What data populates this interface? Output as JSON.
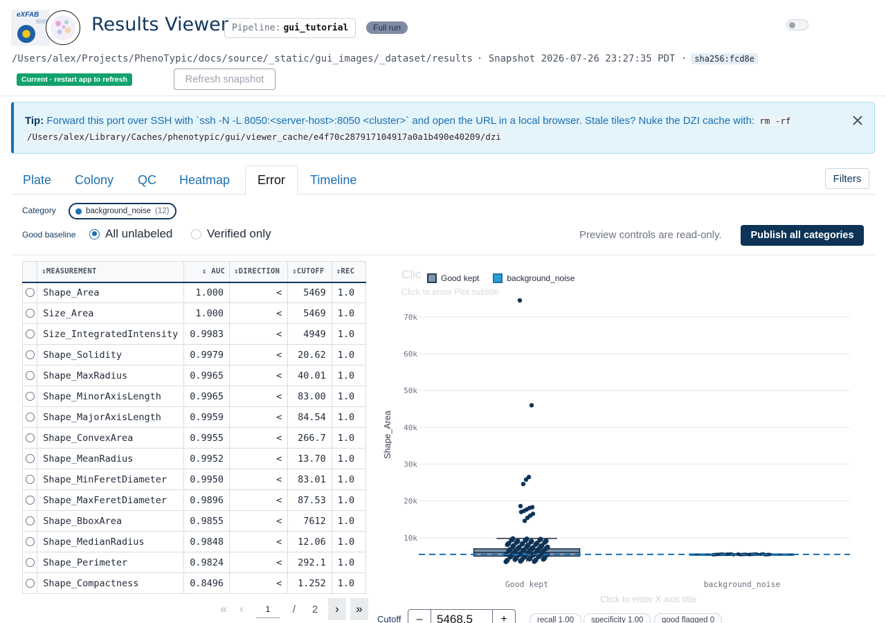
{
  "header": {
    "title": "Results Viewer",
    "pipeline_key": "Pipeline:",
    "pipeline_value": "gui_tutorial",
    "run_badge": "Full run",
    "path": "/Users/alex/Projects/PhenoTypic/docs/source/_static/gui_images/_dataset/results",
    "snapshot": "· Snapshot 2026-07-26 23:27:35 PDT ·",
    "hash": "sha256:fcd8e",
    "current_badge": "Current · restart app to refresh",
    "refresh_label": "Refresh snapshot",
    "logo_text": "eXFAB"
  },
  "tip": {
    "label": "Tip:",
    "text1": "Forward this port over SSH with `ssh -N -L 8050:<server-host>:8050 <cluster>` and open the URL in a local browser. Stale tiles? Nuke the DZI cache with:",
    "code1": "rm -rf",
    "code2": "/Users/alex/Library/Caches/phenotypic/gui/viewer_cache/e4f70c287917104917a0a1b490e40209/dzi"
  },
  "tabs": [
    "Plate",
    "Colony",
    "QC",
    "Heatmap",
    "Error",
    "Timeline"
  ],
  "active_tab": "Error",
  "filters_label": "Filters",
  "controls": {
    "category_label": "Category",
    "category_name": "background_noise",
    "category_count": "(12)",
    "baseline_label": "Good baseline",
    "opt_all": "All unlabeled",
    "opt_verified": "Verified only",
    "preview_note": "Preview controls are read-only.",
    "publish_label": "Publish all categories"
  },
  "table": {
    "headers": [
      "⇕MEASUREMENT",
      "⇕ AUC",
      "⇕DIRECTION",
      "⇕CUTOFF",
      "⇕REC"
    ],
    "rows": [
      [
        "Shape_Area",
        "1.000",
        "<",
        "5469",
        "1.0"
      ],
      [
        "Size_Area",
        "1.000",
        "<",
        "5469",
        "1.0"
      ],
      [
        "Size_IntegratedIntensity",
        "0.9983",
        "<",
        "4949",
        "1.0"
      ],
      [
        "Shape_Solidity",
        "0.9979",
        "<",
        "20.62",
        "1.0"
      ],
      [
        "Shape_MaxRadius",
        "0.9965",
        "<",
        "40.01",
        "1.0"
      ],
      [
        "Shape_MinorAxisLength",
        "0.9965",
        "<",
        "83.00",
        "1.0"
      ],
      [
        "Shape_MajorAxisLength",
        "0.9959",
        "<",
        "84.54",
        "1.0"
      ],
      [
        "Shape_ConvexArea",
        "0.9955",
        "<",
        "266.7",
        "1.0"
      ],
      [
        "Shape_MeanRadius",
        "0.9952",
        "<",
        "13.70",
        "1.0"
      ],
      [
        "Shape_MinFeretDiameter",
        "0.9950",
        "<",
        "83.01",
        "1.0"
      ],
      [
        "Shape_MaxFeretDiameter",
        "0.9896",
        "<",
        "87.53",
        "1.0"
      ],
      [
        "Shape_BboxArea",
        "0.9855",
        "<",
        "7612",
        "1.0"
      ],
      [
        "Shape_MedianRadius",
        "0.9848",
        "<",
        "12.06",
        "1.0"
      ],
      [
        "Shape_Perimeter",
        "0.9824",
        "<",
        "292.1",
        "1.0"
      ],
      [
        "Shape_Compactness",
        "0.8496",
        "<",
        "1.252",
        "1.0"
      ]
    ]
  },
  "pager": {
    "current": "1",
    "sep": "/",
    "total": "2"
  },
  "chart_placeholders": {
    "title": "Clic",
    "subtitle": "Click to enter Plot subtitle",
    "xtitle": "Click to enter X axis title"
  },
  "chart_data": {
    "type": "box",
    "ylabel": "Shape_Area",
    "categories": [
      "Good kept",
      "background_noise"
    ],
    "legend": [
      "Good kept",
      "background_noise"
    ],
    "y_ticks": [
      10000,
      20000,
      30000,
      40000,
      50000,
      60000,
      70000
    ],
    "y_tick_labels": [
      "10k",
      "20k",
      "30k",
      "40k",
      "50k",
      "60k",
      "70k"
    ],
    "ylim": [
      0,
      76000
    ],
    "cutoff_line": 5468.5,
    "boxes": [
      {
        "name": "Good kept",
        "q1": 5000,
        "median": 6000,
        "q3": 7000,
        "whisker_low": 3500,
        "whisker_high": 9800,
        "outliers": [
          74500,
          46000,
          26500,
          25800,
          24600,
          18600,
          18300,
          18100,
          17700,
          17300,
          17000,
          16500,
          16000,
          15400,
          14600
        ]
      },
      {
        "name": "background_noise",
        "q1": 5400,
        "median": 5500,
        "q3": 5600,
        "whisker_low": 5300,
        "whisker_high": 5700,
        "outliers": []
      }
    ],
    "colors": {
      "good": "#7d95b0",
      "noise": "#2e9fd4",
      "points": "#0e3357",
      "cutoff": "#1a6fb0"
    }
  },
  "cutoff": {
    "label": "Cutoff",
    "minus": "–",
    "value": "5468.5",
    "plus": "+",
    "recall": "recall 1.00",
    "specificity": "specificity 1.00",
    "flagged": "good flagged 0"
  }
}
